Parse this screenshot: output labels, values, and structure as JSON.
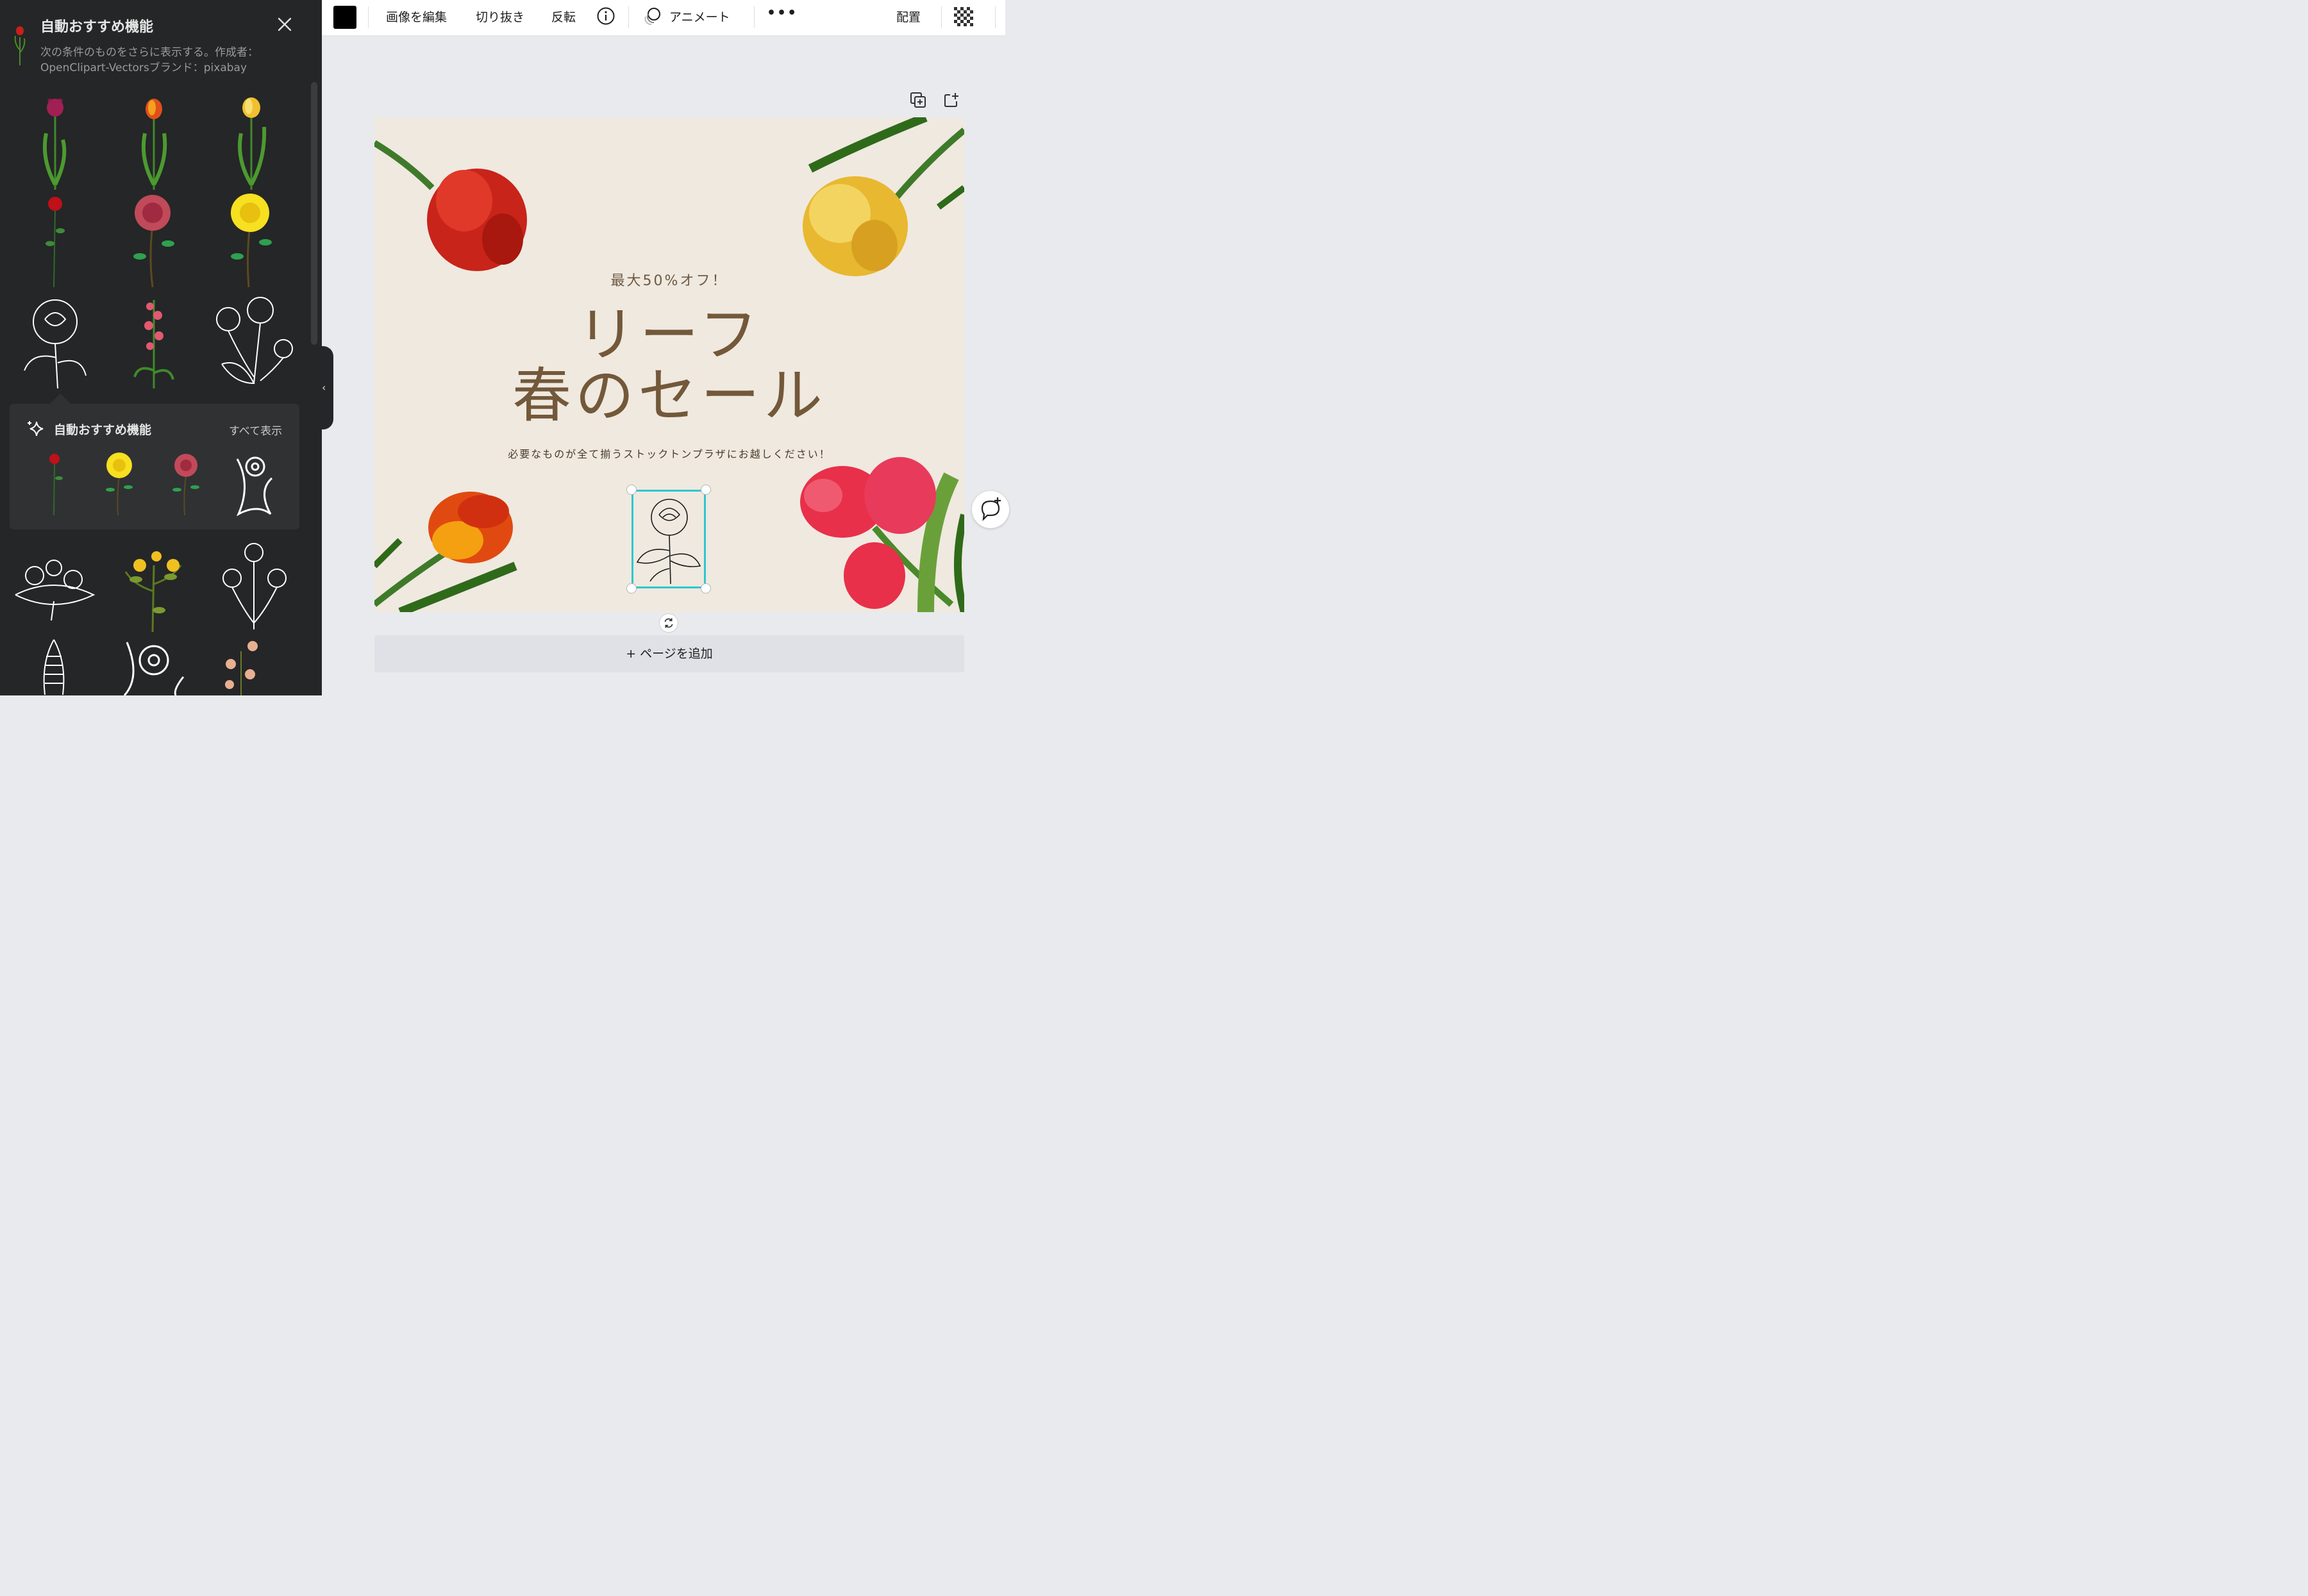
{
  "panel": {
    "title": "自動おすすめ機能",
    "description": "次の条件のものをさらに表示する。作成者：OpenClipart-Vectorsブランド：pixabay",
    "recommend_box": {
      "title": "自動おすすめ機能",
      "show_all": "すべて表示"
    },
    "grid_items": [
      "purple-tulip",
      "orange-tulip",
      "yellow-tulip",
      "red-rose-stem",
      "pink-rose",
      "yellow-rose",
      "white-rose-lineart",
      "pink-snapdragon",
      "white-poppy-lineart",
      "white-flower-bouquet",
      "yellow-wildflowers",
      "white-tulip-lineart",
      "white-hyacinth",
      "white-daisy-lineart",
      "peach-flowers"
    ],
    "recommend_items": [
      "red-rose-stem",
      "yellow-rose",
      "pink-rose",
      "white-daisy-lineart"
    ]
  },
  "toolbar": {
    "edit_image": "画像を編集",
    "crop": "切り抜き",
    "flip": "反転",
    "animate": "アニメート",
    "more": "•••",
    "position": "配置",
    "color": "#000000"
  },
  "design": {
    "subtitle": "最大50%オフ！",
    "title_line1": "リーフ",
    "title_line2": "春のセール",
    "description": "必要なものが全て揃うストックトンプラザにお越しください！",
    "background": "#efe9e0",
    "text_color": "#73583a"
  },
  "add_page_label": "+ ページを追加",
  "selection_color": "#2ec6d0"
}
